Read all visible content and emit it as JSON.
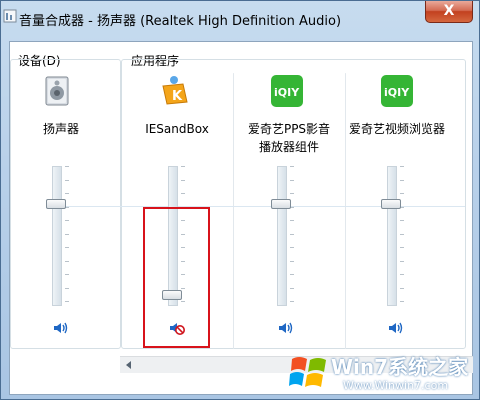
{
  "window": {
    "title": "音量合成器 - 扬声器 (Realtek High Definition Audio)",
    "close_label": "X"
  },
  "groups": {
    "device_label": "设备(D)",
    "apps_label": "应用程序"
  },
  "channels": [
    {
      "name": "扬声器",
      "icon": "speaker-device-icon",
      "level": 0.75,
      "muted": false
    },
    {
      "name": "IESandBox",
      "icon": "iesandbox-app-icon",
      "level": 0.05,
      "muted": true
    },
    {
      "name_line1": "爱奇艺PPS影音",
      "name_line2": "播放器组件",
      "icon": "iqiyi-icon",
      "level": 0.75,
      "muted": false
    },
    {
      "name": "爱奇艺视频浏览器",
      "icon": "iqiyi-icon",
      "level": 0.75,
      "muted": false
    }
  ],
  "watermark": {
    "brand": "Win7系统之家",
    "url": "Www.Winwin7.com"
  },
  "colors": {
    "highlight": "#d8131b",
    "iqiyi_green": "#35b535",
    "speaker_blue": "#1f67c4"
  }
}
